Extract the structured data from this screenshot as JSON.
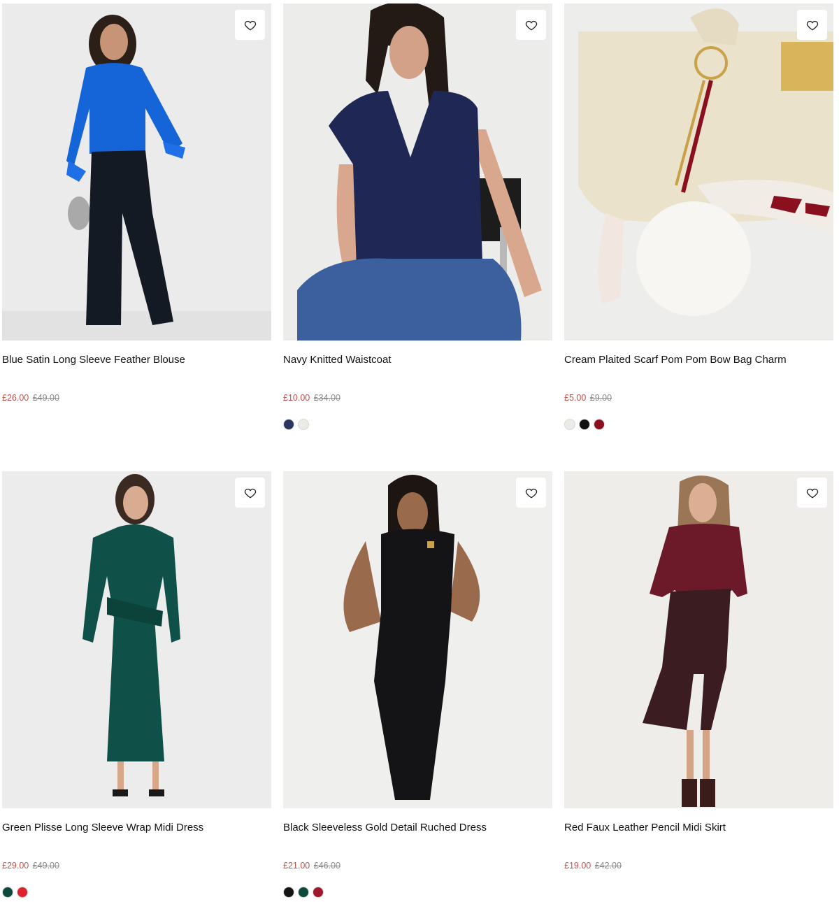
{
  "products": [
    {
      "title": "Blue Satin Long Sleeve Feather Blouse",
      "price_now": "£26.00",
      "price_was": "£49.00",
      "swatches": [],
      "image": "model-blue-satin-blouse"
    },
    {
      "title": "Navy Knitted Waistcoat",
      "price_now": "£10.00",
      "price_was": "£34.00",
      "swatches": [
        "#2a3560",
        "#ecebe5"
      ],
      "image": "model-navy-waistcoat"
    },
    {
      "title": "Cream Plaited Scarf Pom Pom Bow Bag Charm",
      "price_now": "£5.00",
      "price_was": "£9.00",
      "swatches": [
        "#ecebe5",
        "#111111",
        "#8a1020"
      ],
      "image": "bag-charm-cream"
    },
    {
      "title": "Green Plisse Long Sleeve Wrap Midi Dress",
      "price_now": "£29.00",
      "price_was": "£49.00",
      "swatches": [
        "#0d4a3e",
        "#e0202c"
      ],
      "image": "model-green-plisse-dress"
    },
    {
      "title": "Black Sleeveless Gold Detail Ruched Dress",
      "price_now": "£21.00",
      "price_was": "£46.00",
      "swatches": [
        "#141414",
        "#0d4a3e",
        "#a0182c"
      ],
      "image": "model-black-ruched-dress"
    },
    {
      "title": "Red Faux Leather Pencil Midi Skirt",
      "price_now": "£19.00",
      "price_was": "£42.00",
      "swatches": [],
      "image": "model-red-leather-skirt"
    }
  ],
  "icons": {
    "favourite": "heart-outline-icon"
  },
  "colors": {
    "sale_price": "#c4504b",
    "was_price": "#8a8a8a"
  }
}
